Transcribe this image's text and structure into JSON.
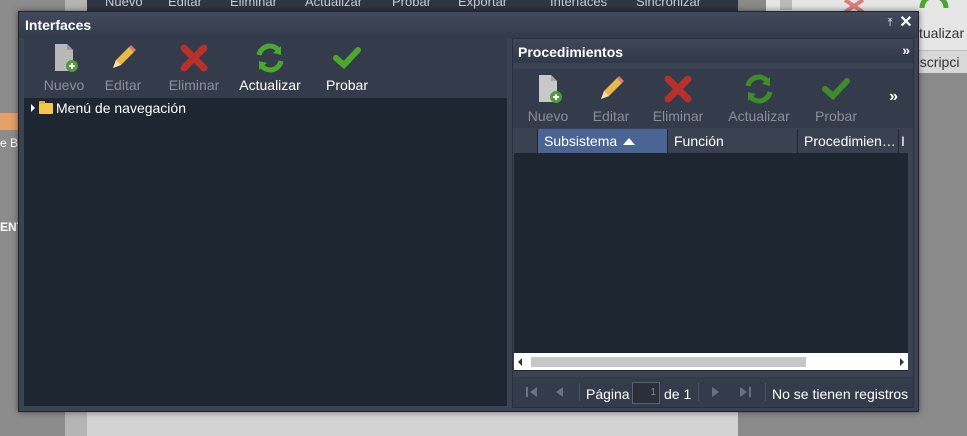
{
  "background": {
    "topbar_items": [
      "Nuevo",
      "Editar",
      "Eliminar",
      "Actualizar",
      "Probar",
      "Exportar",
      "Interfaces",
      "Sincronizar"
    ],
    "left_text_1": "e Bi",
    "left_text_2": "ENT",
    "right_toolbar_label": "ctualizar",
    "right_column_header": "escripci"
  },
  "window": {
    "title": "Interfaces",
    "pin_icon": "⤒",
    "close_icon": "✕"
  },
  "left_panel": {
    "toolbar": [
      {
        "label": "Nuevo",
        "icon": "new-document-icon",
        "enabled": false
      },
      {
        "label": "Editar",
        "icon": "pencil-icon",
        "enabled": false
      },
      {
        "label": "Eliminar",
        "icon": "delete-x-icon",
        "enabled": false
      },
      {
        "label": "Actualizar",
        "icon": "refresh-icon",
        "enabled": true
      },
      {
        "label": "Probar",
        "icon": "checkmark-icon",
        "enabled": true
      }
    ],
    "tree_root": "Menú de navegación"
  },
  "right_panel": {
    "title": "Procedimientos",
    "collapse_icon": "»",
    "more_icon": "»",
    "toolbar": [
      {
        "label": "Nuevo",
        "icon": "new-document-icon",
        "enabled": true
      },
      {
        "label": "Editar",
        "icon": "pencil-icon",
        "enabled": false
      },
      {
        "label": "Eliminar",
        "icon": "delete-x-icon",
        "enabled": false
      },
      {
        "label": "Actualizar",
        "icon": "refresh-icon",
        "enabled": false
      },
      {
        "label": "Probar",
        "icon": "checkmark-icon",
        "enabled": false
      }
    ],
    "columns": [
      "Subsistema",
      "Función",
      "Procedimien…",
      "I"
    ],
    "sorted_column": "Subsistema",
    "pager": {
      "page_label": "Página",
      "page_value": "1",
      "of_label": "de 1",
      "status": "No se tienen registros"
    }
  },
  "colors": {
    "window_bg": "#3b4252",
    "panel_bg": "#1e2631",
    "sorted_header": "#4a6593",
    "refresh_green": "#4aa82f",
    "delete_red": "#d23b2f"
  }
}
